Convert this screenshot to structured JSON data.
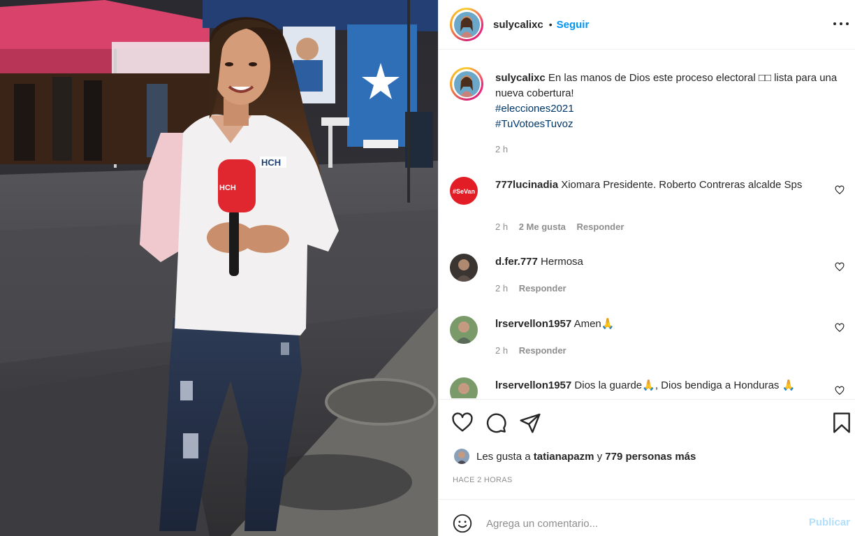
{
  "post": {
    "username": "sulycalixc",
    "follow_label": "Seguir",
    "caption_text": "En las manos de Dios este proceso electoral □□ lista para una nueva cobertura!",
    "hashtags": [
      "#elecciones2021",
      "#TuVotoesTuvoz"
    ],
    "caption_time": "2 h"
  },
  "comments": [
    {
      "username": "777lucinadia",
      "text": "Xiomara Presidente. Roberto Contreras alcalde Sps",
      "time": "2 h",
      "likes": "2 Me gusta",
      "reply": "Responder",
      "avatar_text": "#SeVan"
    },
    {
      "username": "d.fer.777",
      "text": "Hermosa",
      "time": "2 h",
      "reply": "Responder"
    },
    {
      "username": "lrservellon1957",
      "text": "Amen🙏",
      "time": "2 h",
      "reply": "Responder"
    },
    {
      "username": "lrservellon1957",
      "text": "Dios la guarde🙏, Dios bendiga a Honduras 🙏"
    }
  ],
  "engagement": {
    "likes_prefix": "Les gusta a",
    "liked_by": "tatianapazm",
    "likes_conjunction": "y",
    "likes_others": "779 personas más",
    "time_ago": "HACE 2 HORAS"
  },
  "composer": {
    "placeholder": "Agrega un comentario...",
    "publish_label": "Publicar"
  },
  "photo": {
    "mic_label": "HCH",
    "shirt_logo": "HCH"
  },
  "colors": {
    "accent": "#0095f6",
    "publish_disabled": "#b2dffc",
    "hashtag": "#00376b",
    "muted": "#8e8e8e",
    "mic_red": "#e0262e",
    "flag_blue": "#2f6fb8"
  },
  "icons": [
    "more-options-icon",
    "heart-icon",
    "comment-icon",
    "share-icon",
    "bookmark-icon",
    "emoji-icon",
    "small-heart-icon"
  ]
}
